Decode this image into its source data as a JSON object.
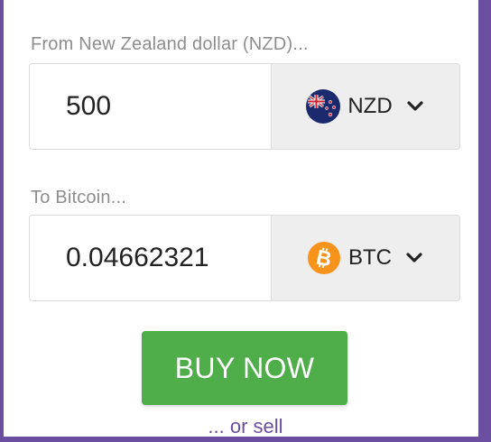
{
  "from": {
    "label": "From New Zealand dollar (NZD)...",
    "amount": "500",
    "currency_code": "NZD",
    "flag_icon": "nz-flag-icon"
  },
  "to": {
    "label": "To Bitcoin...",
    "amount": "0.04662321",
    "currency_code": "BTC",
    "flag_icon": "bitcoin-icon"
  },
  "buy_label": "BUY NOW",
  "sell_link": "... or sell",
  "colors": {
    "accent": "#6a4fa0",
    "buy_button": "#4fae4a",
    "bitcoin": "#f7931a",
    "nz_navy": "#1a2a6c"
  }
}
